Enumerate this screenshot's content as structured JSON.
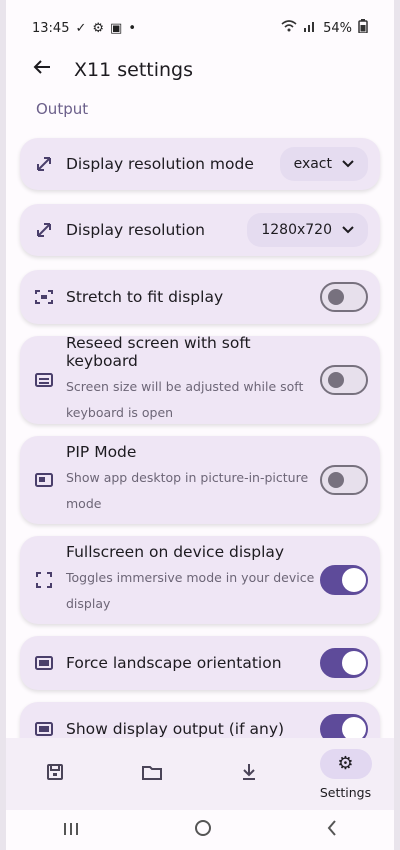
{
  "status_bar": {
    "time": "13:45",
    "battery": "54%"
  },
  "header": {
    "title": "X11 settings"
  },
  "section_title": "Output",
  "settings": [
    {
      "id": "display-resolution-mode",
      "label": "Display resolution mode",
      "control": "dropdown",
      "value": "exact",
      "icon": "resize-icon"
    },
    {
      "id": "display-resolution",
      "label": "Display resolution",
      "control": "dropdown",
      "value": "1280x720",
      "icon": "resize-icon"
    },
    {
      "id": "stretch-to-fit",
      "label": "Stretch to fit display",
      "control": "toggle",
      "on": false,
      "icon": "fit-screen-icon"
    },
    {
      "id": "reseed-screen",
      "label": "Reseed screen with soft keyboard",
      "subtitle": "Screen size will be adjusted while soft keyboard is open",
      "control": "toggle",
      "on": false,
      "icon": "keyboard-icon"
    },
    {
      "id": "pip-mode",
      "label": "PIP Mode",
      "subtitle": "Show app desktop in picture-in-picture mode",
      "control": "toggle",
      "on": false,
      "icon": "pip-icon"
    },
    {
      "id": "fullscreen",
      "label": "Fullscreen on device display",
      "subtitle": "Toggles immersive mode in your device display",
      "control": "toggle",
      "on": true,
      "icon": "fullscreen-icon"
    },
    {
      "id": "force-landscape",
      "label": "Force landscape orientation",
      "control": "toggle",
      "on": true,
      "icon": "landscape-icon"
    },
    {
      "id": "show-display-output",
      "label": "Show display output (if any)",
      "control": "toggle",
      "on": true,
      "icon": "display-output-icon"
    }
  ],
  "bottom_nav": [
    {
      "id": "save",
      "icon": "save-icon",
      "label": ""
    },
    {
      "id": "folder",
      "icon": "folder-icon",
      "label": ""
    },
    {
      "id": "download",
      "icon": "download-icon",
      "label": ""
    },
    {
      "id": "settings",
      "icon": "gear-icon",
      "label": "Settings",
      "active": true
    }
  ]
}
